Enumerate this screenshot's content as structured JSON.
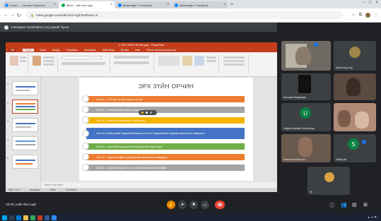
{
  "browser": {
    "tabs": [
      {
        "label": "Zoom / ... Ажлын Хэрэглэгч",
        "fav": "#2d8cff",
        "active": false
      },
      {
        "label": "Meet – rabr-kxvr-sgh",
        "fav": "#00ac47",
        "active": true
      },
      {
        "label": "Messenger / Facebook",
        "fav": "#0084ff",
        "active": false
      },
      {
        "label": "Messenger / Facebook",
        "fav": "#0084ff",
        "active": false
      }
    ],
    "url": "meet.google.com/rabr-kxvr-sgh?authuser=0",
    "icons": [
      "back-icon",
      "forward-icon",
      "reload-icon",
      "star-icon",
      "extension-icon",
      "profile-icon"
    ]
  },
  "meet": {
    "presenting_text": "Interegnet surtalzaltsul (та) үүнийг бүлэг",
    "meeting_time": "10:09 | udhr-fkuo-aqfr",
    "participants": [
      {
        "name": "",
        "avatar_color": "#7a6a55",
        "letter": ""
      },
      {
        "name": "Mandhuug Нэр",
        "avatar_color": "#a0854a",
        "letter": ""
      },
      {
        "name": "Amrsaikh Bolgorsjan",
        "avatar_color": "#3c4043",
        "letter": ""
      },
      {
        "name": "",
        "avatar_color": "#5b4a3f",
        "letter": ""
      },
      {
        "name": "Hulgan Mantsar Erdenetsog",
        "avatar_color": "#0b8043",
        "letter": "U"
      },
      {
        "name": "",
        "avatar_color": "#b08a74",
        "letter": ""
      },
      {
        "name": "anaar Nemenbuyan",
        "avatar_color": "#6a5a4e",
        "letter": ""
      },
      {
        "name": "Sarlag Ab",
        "avatar_color": "#0b8043",
        "letter": "S"
      },
      {
        "name": "Ta",
        "avatar_color": "#d9a441",
        "letter": ""
      }
    ]
  },
  "ppt": {
    "title_bar": "3. ЭРХ ЗҮЙН ОРЧИН.pptx - PowerPoint",
    "menu": [
      "File",
      "Home",
      "Insert",
      "Design",
      "Transitions",
      "Animations",
      "Slide Show",
      "Review",
      "View",
      "Tell me what you want to do"
    ],
    "slide_title": "ЭРХ ЗҮЙН ОРЧИН",
    "items": [
      {
        "text": "2002 он – УИХ-ын Засгийн газрын тогтоол",
        "color": "#ed7d31"
      },
      {
        "text": "2003 он – Нийгмийн даатгалын тухай хууль",
        "color": "#a5a5a5"
      },
      {
        "text": "2007 он – Нийгмийн халамжийн тухай хууль",
        "color": "#f4b400"
      },
      {
        "text": "2010 он Хүний эрхийн Үндэсний Комиссын илтгэл / Хөдөлмөрийн хуулийн шинэчилсэн найруулга",
        "color": "#4472c4"
      },
      {
        "text": "2016 он – Хөгжлийн бэрхшээлтэй хүний эрхийн тухай хууль",
        "color": "#70ad47"
      },
      {
        "text": "2017 он – Эрүүл мэндийн тухай хуулийн шинэчилсэн найруулга",
        "color": "#ed7d31"
      },
      {
        "text": "2018 он – Засгийн газрын тогтоол / Үйл ажиллагааны хөтөлбөр",
        "color": "#a5a5a5"
      }
    ],
    "notes": "Click to add notes",
    "status": [
      "Slide 2 of 9",
      "Mongolian",
      "Notes",
      "Comments"
    ]
  }
}
